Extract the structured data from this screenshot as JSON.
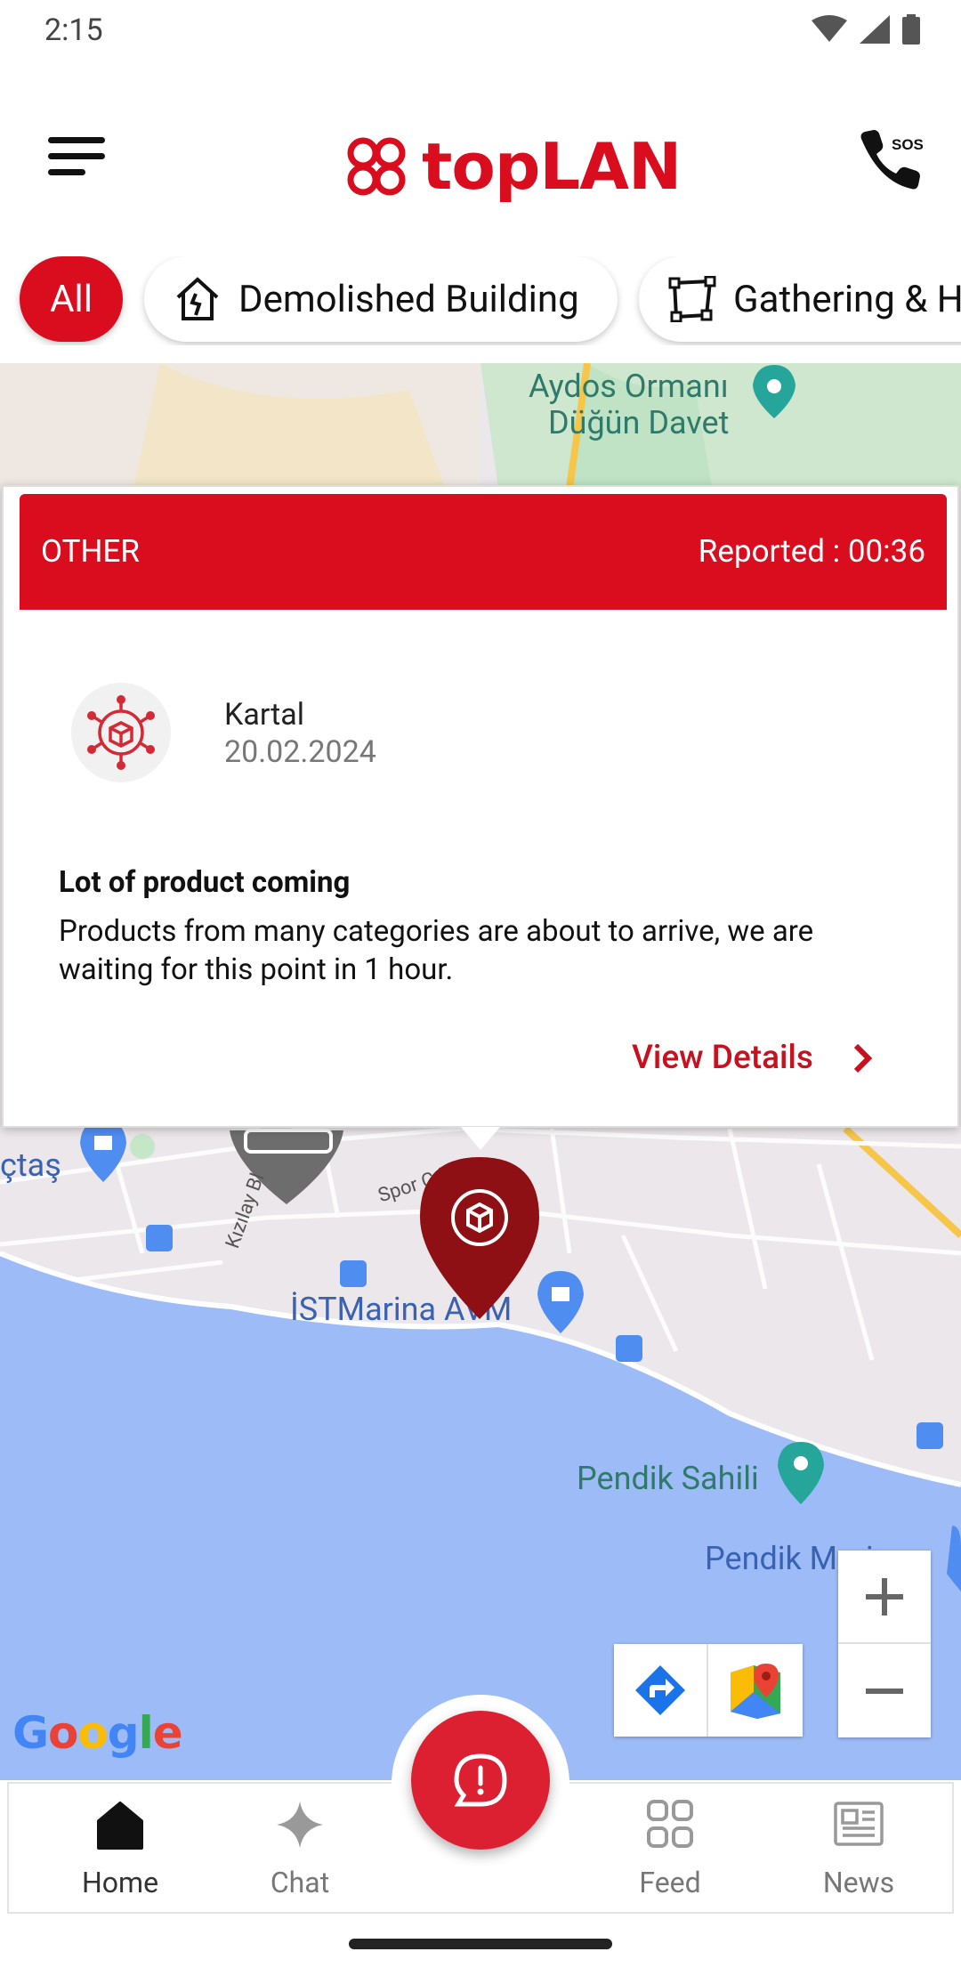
{
  "status_bar": {
    "time": "2:15"
  },
  "header": {
    "logo_text": "topLAN",
    "sos_label": "SOS"
  },
  "filters": [
    {
      "label": "All",
      "active": true
    },
    {
      "label": "Demolished Building",
      "icon": "house-icon"
    },
    {
      "label": "Gathering & H",
      "icon": "area-polygon-icon"
    }
  ],
  "map": {
    "labels": {
      "aydos_line1": "Aydos Ormanı",
      "aydos_line2": "Düğün Davet",
      "koctas": "çtaş",
      "istmarina": "İSTMarina AVM",
      "pendik_sahili": "Pendik Sahili",
      "pendik_marina": "Pendik Marina",
      "kizilay": "Kızılay Bl",
      "spor": "Spor Cd"
    },
    "google": "Google"
  },
  "popup": {
    "category": "OTHER",
    "reported": "Reported : 00:36",
    "place": "Kartal",
    "date": "20.02.2024",
    "title": "Lot of product coming",
    "description": "Products from many categories are about to arrive, we are waiting for this point in 1 hour.",
    "link": "View Details"
  },
  "bottom_nav": [
    {
      "label": "Home",
      "icon": "home-icon",
      "active": true
    },
    {
      "label": "Chat",
      "icon": "sparkle-icon"
    },
    {
      "label": "Feed",
      "icon": "grid-icon"
    },
    {
      "label": "News",
      "icon": "newspaper-icon"
    }
  ],
  "colors": {
    "brand": "#d90d1e",
    "marker": "#8e0f14",
    "water": "#9dbcf7"
  }
}
